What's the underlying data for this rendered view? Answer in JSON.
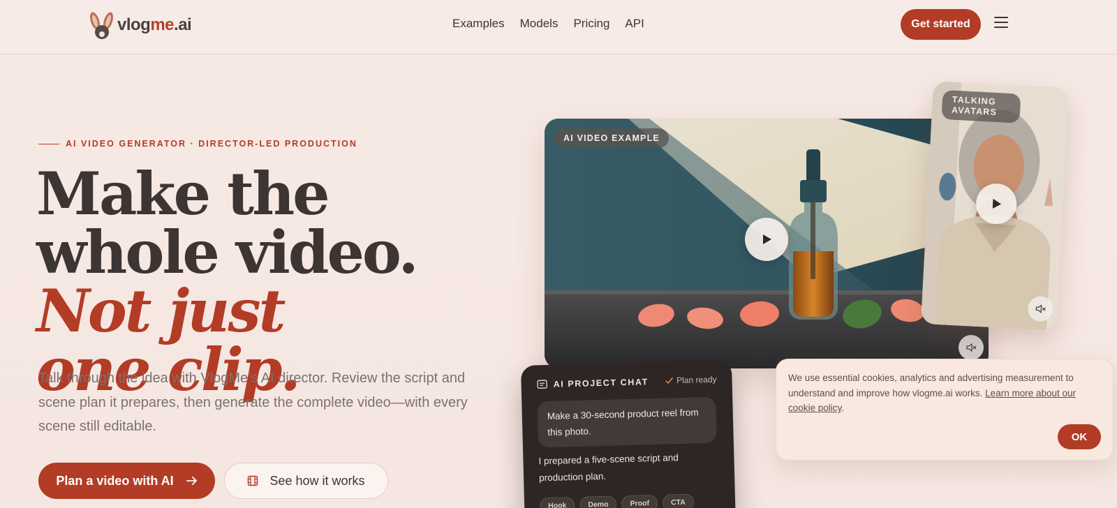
{
  "header": {
    "logo": {
      "text_main": "vlog",
      "text_accent": "me",
      "text_suffix": ".ai",
      "icon": "bunny-ears-icon"
    },
    "nav": [
      "Examples",
      "Models",
      "Pricing",
      "API"
    ],
    "cta_label": "Get started",
    "menu_icon": "hamburger-menu-icon"
  },
  "hero": {
    "eyebrow": "AI VIDEO GENERATOR · DIRECTOR-LED PRODUCTION",
    "headline_part1": "Make the whole video.",
    "headline_em_line1": "Not just",
    "headline_em_line2": "one clip.",
    "subcopy": "Talk through the idea with VlogMe’s AI director. Review the script and scene plan it prepares, then generate the complete video—with every scene still editable.",
    "primary_button": "Plan a video with AI",
    "secondary_button": "See how it works"
  },
  "video_card": {
    "tag": "AI VIDEO EXAMPLE",
    "play_icon": "play-icon",
    "mute_icon": "mute-icon"
  },
  "avatar_card": {
    "tag": "TALKING AVATARS"
  },
  "chat": {
    "title": "AI PROJECT CHAT",
    "status": "Plan ready",
    "user_message": "Make a 30-second product reel from this photo.",
    "ai_message": "I prepared a five-scene script and production plan.",
    "chips": [
      "Hook",
      "Demo",
      "Proof",
      "CTA"
    ]
  },
  "cookie": {
    "text": "We use essential cookies, analytics and advertising measurement to understand and improve how vlogme.ai works.",
    "link": "Learn more about our cookie policy",
    "suffix": ".",
    "ok_label": "OK"
  },
  "colors": {
    "brand": "#b23c25",
    "background": "#f6e9e4",
    "text": "#3d3533",
    "chat_bg": "#2d2624"
  }
}
